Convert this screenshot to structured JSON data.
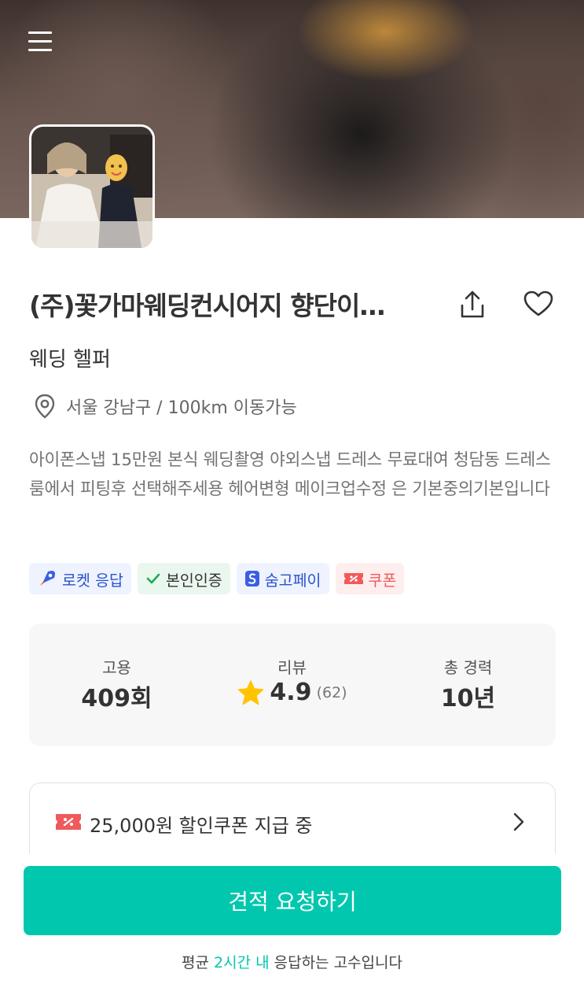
{
  "header": {
    "menu_icon": "hamburger-menu-icon"
  },
  "profile": {
    "name": "(주)꽃가마웨딩컨시어지 향단이…",
    "category": "웨딩 헬퍼",
    "location": "서울 강남구 / 100km 이동가능",
    "description": "아이폰스냅 15만원 본식 웨딩촬영 야외스냅 드레스 무료대여 청담동 드레스룸에서 피팅후 선택해주세용 헤어변형 메이크업수정 은 기본중의기본입니다",
    "share_icon": "share-icon",
    "like_icon": "heart-icon"
  },
  "badges": [
    {
      "label": "로켓 응답",
      "icon": "rocket-icon",
      "bg": "#eef3ff",
      "color": "#2b52cc"
    },
    {
      "label": "본인인증",
      "icon": "check-icon",
      "bg": "#eaf7ee",
      "color": "#333333"
    },
    {
      "label": "숨고페이",
      "icon": "soomgo-pay-icon",
      "bg": "#eef3ff",
      "color": "#2b52cc"
    },
    {
      "label": "쿠폰",
      "icon": "coupon-icon",
      "bg": "#ffeeee",
      "color": "#f05a5a"
    }
  ],
  "stats": {
    "hire": {
      "label": "고용",
      "value": "409회"
    },
    "review": {
      "label": "리뷰",
      "rating": "4.9",
      "count": "(62)"
    },
    "career": {
      "label": "총 경력",
      "value": "10년"
    }
  },
  "coupon": {
    "text": "25,000원 할인쿠폰 지급 중"
  },
  "cta": {
    "label": "견적 요청하기",
    "note_prefix": "평균 ",
    "note_highlight": "2시간 내",
    "note_suffix": " 응답하는 고수입니다"
  },
  "colors": {
    "accent": "#00c7ae",
    "star": "#ffc400",
    "coupon_red": "#f05a5a"
  }
}
